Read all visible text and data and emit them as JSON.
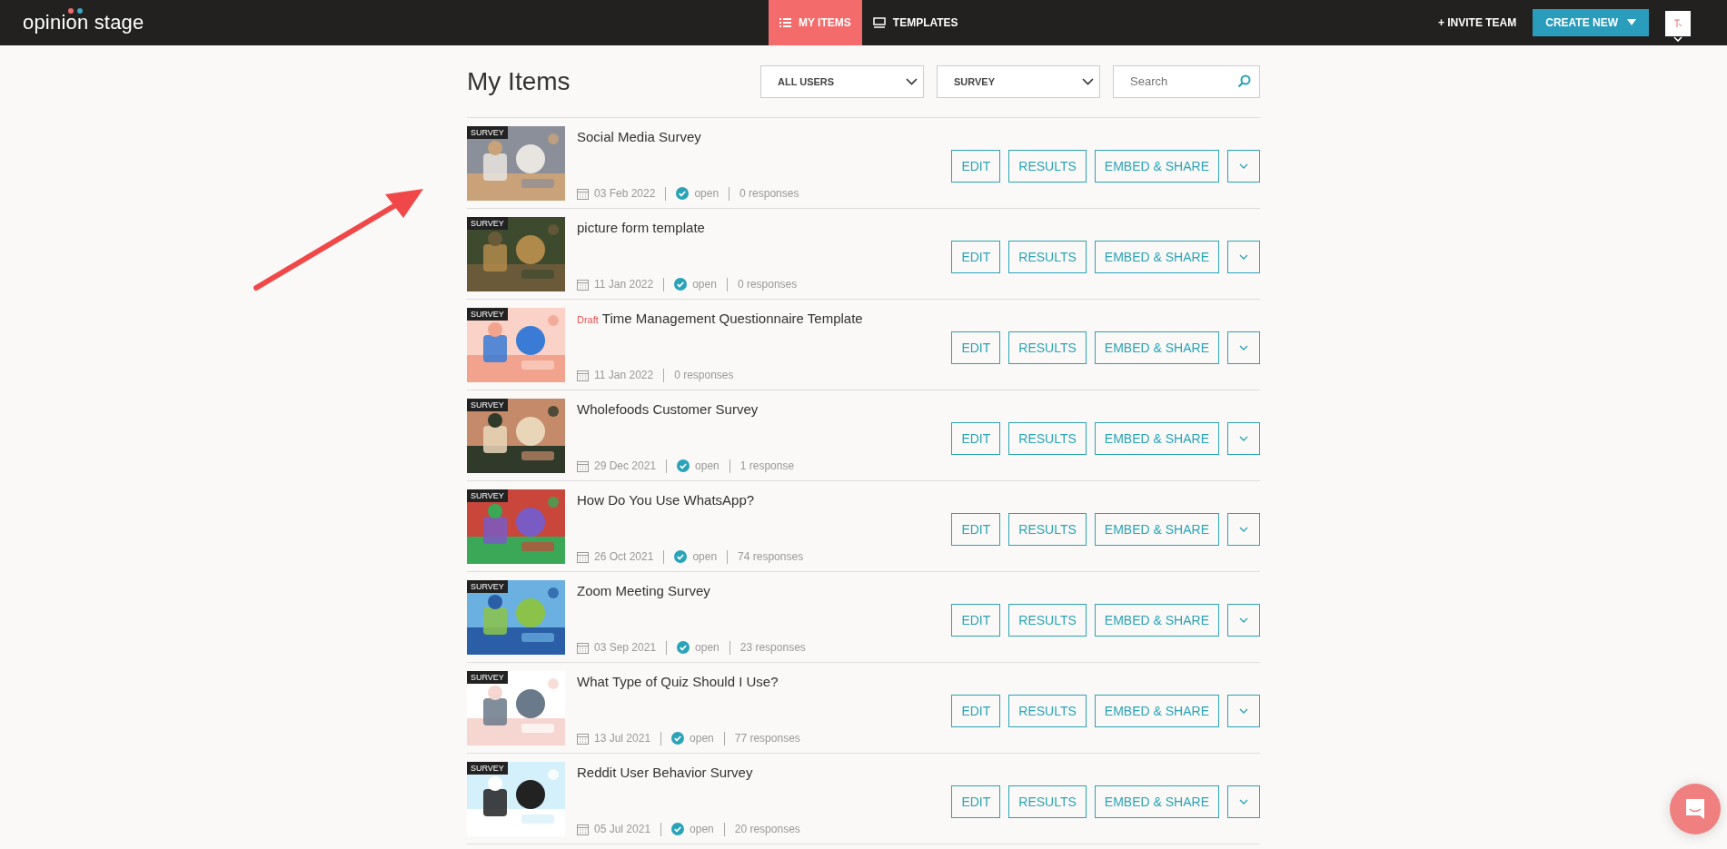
{
  "header": {
    "logo": "opinion stage",
    "tabs": [
      {
        "label": "MY ITEMS",
        "selected": true
      },
      {
        "label": "TEMPLATES",
        "selected": false
      }
    ],
    "invite": "+ INVITE TEAM",
    "create": "CREATE NEW"
  },
  "page": {
    "title": "My Items",
    "filters": [
      "ALL USERS",
      "SURVEY"
    ],
    "search": {
      "placeholder": "Search"
    }
  },
  "items": [
    {
      "type": "SURVEY",
      "title": "Social Media Survey",
      "date": "03 Feb 2022",
      "status": "open",
      "responses": "0 responses",
      "actions": [
        "EDIT",
        "RESULTS",
        "EMBED & SHARE"
      ]
    },
    {
      "type": "SURVEY",
      "title": "picture form template",
      "date": "11 Jan 2022",
      "status": "open",
      "responses": "0 responses",
      "actions": [
        "EDIT",
        "RESULTS",
        "EMBED & SHARE"
      ]
    },
    {
      "type": "SURVEY",
      "badge": "Draft",
      "title": "Time Management Questionnaire Template",
      "date": "11 Jan 2022",
      "responses": "0 responses",
      "actions": [
        "EDIT",
        "RESULTS",
        "EMBED & SHARE"
      ]
    },
    {
      "type": "SURVEY",
      "title": "Wholefoods Customer Survey",
      "date": "29 Dec 2021",
      "status": "open",
      "responses": "1 response",
      "actions": [
        "EDIT",
        "RESULTS",
        "EMBED & SHARE"
      ]
    },
    {
      "type": "SURVEY",
      "title": "How Do You Use WhatsApp?",
      "date": "26 Oct 2021",
      "status": "open",
      "responses": "74 responses",
      "actions": [
        "EDIT",
        "RESULTS",
        "EMBED & SHARE"
      ]
    },
    {
      "type": "SURVEY",
      "title": "Zoom Meeting Survey",
      "date": "03 Sep 2021",
      "status": "open",
      "responses": "23 responses",
      "actions": [
        "EDIT",
        "RESULTS",
        "EMBED & SHARE"
      ]
    },
    {
      "type": "SURVEY",
      "title": "What Type of Quiz Should I Use?",
      "date": "13 Jul 2021",
      "status": "open",
      "responses": "77 responses",
      "actions": [
        "EDIT",
        "RESULTS",
        "EMBED & SHARE"
      ]
    },
    {
      "type": "SURVEY",
      "title": "Reddit User Behavior Survey",
      "date": "05 Jul 2021",
      "status": "open",
      "responses": "20 responses",
      "actions": [
        "EDIT",
        "RESULTS",
        "EMBED & SHARE"
      ]
    }
  ]
}
